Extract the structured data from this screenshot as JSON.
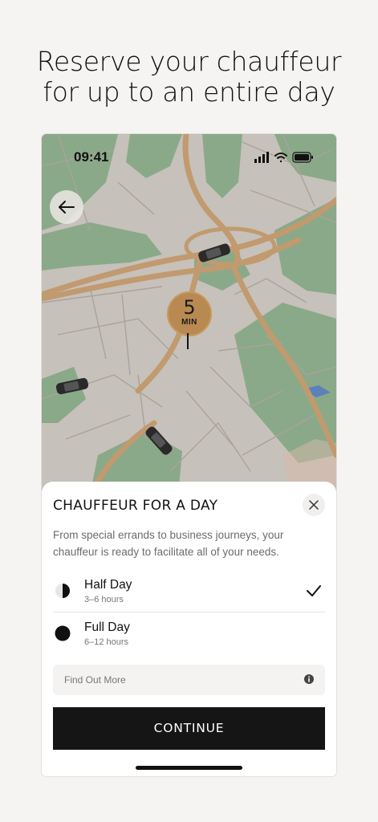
{
  "headline": {
    "line1": "Reserve your chauffeur",
    "line2": "for up to an entire day"
  },
  "status_bar": {
    "time": "09:41",
    "icons": [
      "cellular-signal-icon",
      "wifi-icon",
      "battery-icon"
    ]
  },
  "map": {
    "eta_value": "5",
    "eta_unit": "MIN",
    "colors": {
      "land": "#c5c0b9",
      "park": "#8aa989",
      "road": "#c19a6f",
      "street": "#a9a39c",
      "water": "#5a82b8",
      "pin": "#b88a52"
    }
  },
  "sheet": {
    "title": "CHAUFFEUR FOR A DAY",
    "description": "From special errands to business journeys, your chauffeur is ready to facilitate all of your needs.",
    "options": [
      {
        "label": "Half Day",
        "sub": "3–6 hours",
        "selected": true,
        "icon": "half-circle-icon"
      },
      {
        "label": "Full Day",
        "sub": "6–12 hours",
        "selected": false,
        "icon": "full-circle-icon"
      }
    ],
    "find_out_more": "Find Out More",
    "continue_label": "CONTINUE"
  }
}
